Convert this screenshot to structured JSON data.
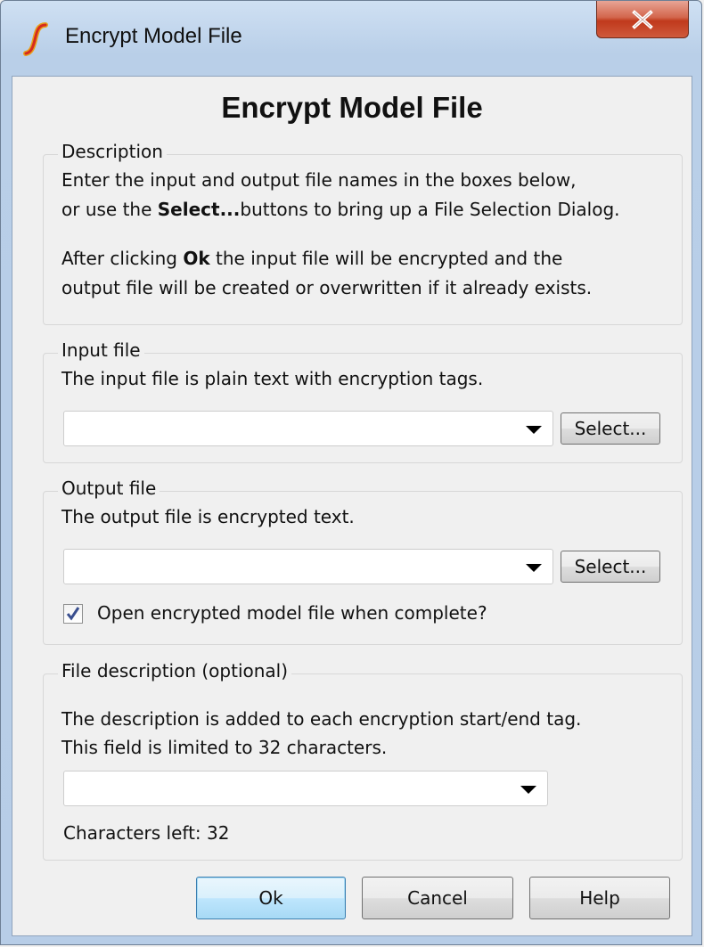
{
  "window": {
    "title": "Encrypt Model File",
    "close_label": "X"
  },
  "dialog": {
    "heading": "Encrypt Model File"
  },
  "description_group": {
    "legend": "Description",
    "line1": "Enter the input and output file names in the boxes below,",
    "line2_prefix": "or use the ",
    "line2_bold": "Select...",
    "line2_suffix": "buttons to bring up a File Selection Dialog.",
    "line3_prefix": "After clicking ",
    "line3_bold": "Ok",
    "line3_suffix": " the input file will be encrypted and the",
    "line4": "output file will be created or overwritten if it already exists."
  },
  "input_group": {
    "legend": "Input file",
    "help": "The input file is plain text with encryption tags.",
    "value": "",
    "select_label": "Select..."
  },
  "output_group": {
    "legend": "Output file",
    "help": "The output file is encrypted text.",
    "value": "",
    "select_label": "Select...",
    "open_checkbox_label": "Open encrypted model file when complete?",
    "open_checkbox_checked": true
  },
  "file_description_group": {
    "legend": "File description (optional)",
    "help_line1": "The description is added to each encryption start/end tag.",
    "help_line2": "This field is limited to 32 characters.",
    "value": "",
    "characters_left": "Characters left: 32"
  },
  "footer": {
    "ok_label": "Ok",
    "cancel_label": "Cancel",
    "help_label": "Help"
  }
}
